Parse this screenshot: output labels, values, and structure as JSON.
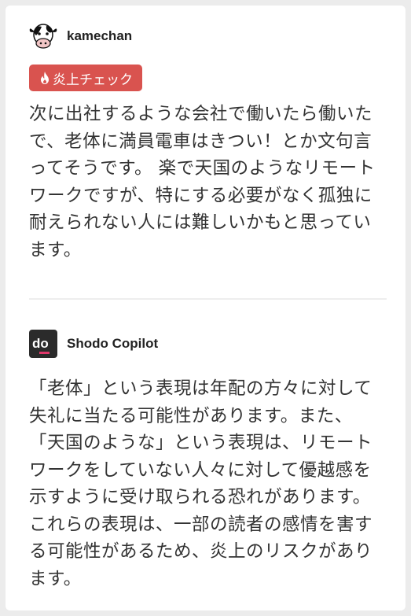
{
  "posts": [
    {
      "author": "kamechan",
      "avatar_icon": "cow-icon",
      "badge": {
        "label": "炎上チェック",
        "icon": "fire-icon",
        "color": "#d9534f"
      },
      "text": "次に出社するような会社で働いたら働いたで、老体に満員電車はきつい！とか文句言ってそうです。 楽で天国のようなリモートワークですが、特にする必要がなく孤独に耐えられない人には難しいかもと思っています。"
    },
    {
      "author": "Shodo Copilot",
      "avatar_icon": "shodo-logo-icon",
      "text": "「老体」という表現は年配の方々に対して失礼に当たる可能性があります。また、「天国のような」という表現は、リモートワークをしていない人々に対して優越感を示すように受け取られる恐れがあります。これらの表現は、一部の読者の感情を害する可能性があるため、炎上のリスクがあります。"
    }
  ]
}
